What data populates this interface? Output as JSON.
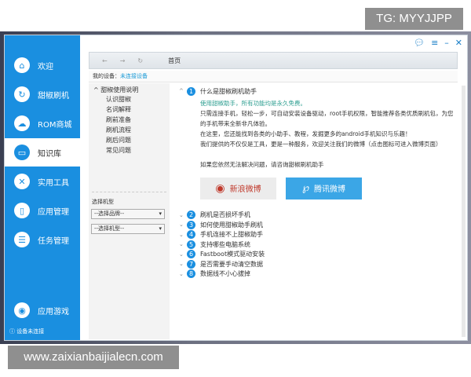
{
  "watermarks": {
    "top": "TG: MYYJJPP",
    "bottom": "www.zaixianbaijialecn.com"
  },
  "sidebar": {
    "items": [
      {
        "label": "欢迎",
        "icon": "home-icon",
        "glyph": "⌂"
      },
      {
        "label": "甜椒刷机",
        "icon": "refresh-icon",
        "glyph": "↻"
      },
      {
        "label": "ROM商城",
        "icon": "cloud-upload-icon",
        "glyph": "☁"
      },
      {
        "label": "知识库",
        "icon": "book-icon",
        "glyph": "▭",
        "active": true
      },
      {
        "label": "实用工具",
        "icon": "tools-icon",
        "glyph": "✕"
      },
      {
        "label": "应用管理",
        "icon": "phone-icon",
        "glyph": "▯"
      },
      {
        "label": "任务管理",
        "icon": "list-icon",
        "glyph": "☰"
      }
    ],
    "games": {
      "label": "应用游戏",
      "icon": "gamepad-icon",
      "glyph": "◉"
    },
    "status": "ⓘ  设备未连接"
  },
  "titlebar": {
    "icons": [
      "comment-icon",
      "menu-icon",
      "minimize-icon",
      "close-icon"
    ]
  },
  "navbar": {
    "back": "←",
    "forward": "→",
    "refresh": "↻",
    "home": "首页"
  },
  "device": {
    "label": "我的设备：",
    "value": "未连接设备"
  },
  "left": {
    "title": "^ 甜椒使用说明",
    "items": [
      "认识甜椒",
      "名词解释",
      "刷前准备",
      "刷机流程",
      "刷后问题",
      "常见问题"
    ],
    "model_label": "选择机型",
    "brand_select": "--选择品牌--",
    "model_select": "--选择机型--"
  },
  "faq": {
    "first": {
      "num": "1",
      "title": "什么是甜椒刷机助手",
      "lines": [
        "使用甜椒助手，所有功能均是永久免费。",
        "只需连接手机，轻松一步，可自动安装设备驱动，root手机权限，智能推荐各类优质刷机包，为您的手机带来全新非凡体验。",
        "在这里，您还能找到各类的小助手、教程，发掘更多的android手机知识与乐趣！",
        "我们提供的不仅仅是工具，更是一种服务，欢迎关注我们的微博（点击图标可进入微博页面）"
      ],
      "help": "如果您依然无法解决问题，请咨询甜椒刷机助手",
      "sina": "新浪微博",
      "tencent": "腾讯微博"
    },
    "items": [
      {
        "num": "2",
        "title": "刷机是否损坏手机"
      },
      {
        "num": "3",
        "title": "如何使用甜椒助手刷机"
      },
      {
        "num": "4",
        "title": "手机连接不上甜椒助手"
      },
      {
        "num": "5",
        "title": "支持哪些电脑系统"
      },
      {
        "num": "6",
        "title": "Fastboot模式驱动安装"
      },
      {
        "num": "7",
        "title": "是否需要手动清空数据"
      },
      {
        "num": "8",
        "title": "数据线不小心拔掉"
      }
    ]
  }
}
